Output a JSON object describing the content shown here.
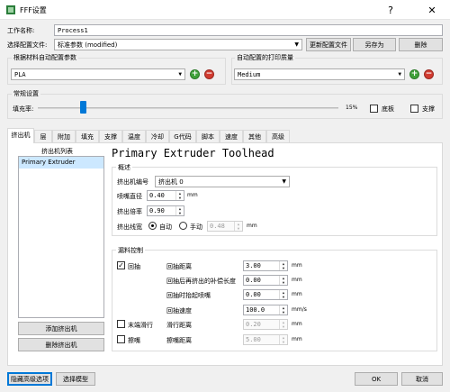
{
  "window": {
    "title": "FFF设置",
    "help_label": "?",
    "close_label": "✕"
  },
  "process": {
    "label": "工作名称:",
    "value": "Process1"
  },
  "profile": {
    "label": "选择配置文件:",
    "value": "标准参数 (modified)",
    "update_button": "更新配置文件",
    "save_as_button": "另存为",
    "delete_button": "删除"
  },
  "material": {
    "group_title": "根据材料自动配置参数",
    "value": "PLA"
  },
  "quality": {
    "group_title": "自动配置的打印质量",
    "value": "Medium"
  },
  "general": {
    "group_title": "常规设置",
    "infill_label": "填充率:",
    "infill_value": "15%",
    "infill_fraction": 0.15,
    "raft_label": "底板",
    "support_label": "支撑"
  },
  "tabs": [
    {
      "label": "挤出机"
    },
    {
      "label": "层"
    },
    {
      "label": "附加"
    },
    {
      "label": "填充"
    },
    {
      "label": "支撑"
    },
    {
      "label": "温度"
    },
    {
      "label": "冷却"
    },
    {
      "label": "G代码"
    },
    {
      "label": "脚本"
    },
    {
      "label": "速度"
    },
    {
      "label": "其他"
    },
    {
      "label": "高级"
    }
  ],
  "extruder_list": {
    "title": "挤出机列表",
    "items": [
      "Primary Extruder"
    ],
    "add_button": "添加挤出机",
    "remove_button": "删除挤出机"
  },
  "extruder": {
    "heading": "Primary Extruder Toolhead",
    "overview_title": "概述",
    "index_label": "挤出机编号",
    "index_value": "挤出机 0",
    "nozzle_label": "喷嘴直径",
    "nozzle_value": "0.40",
    "nozzle_unit": "mm",
    "multiplier_label": "挤出倍率",
    "multiplier_value": "0.90",
    "width_label": "挤出线宽",
    "width_auto": "自动",
    "width_manual": "手动",
    "width_value": "0.48",
    "width_unit": "mm"
  },
  "retraction": {
    "group_title": "漏料控制",
    "retract_label": "回抽",
    "distance_label": "回抽距离",
    "distance_value": "3.00",
    "distance_unit": "mm",
    "extra_label": "回抽后再挤出的补偿长度",
    "extra_value": "0.00",
    "extra_unit": "mm",
    "lift_label": "回抽时抬起喷嘴",
    "lift_value": "0.00",
    "lift_unit": "mm",
    "speed_label": "回抽速度",
    "speed_value": "100.0",
    "speed_unit": "mm/s",
    "coast_label": "末端滑行",
    "coast_dist_label": "滑行距离",
    "coast_value": "0.20",
    "coast_unit": "mm",
    "wipe_label": "擦嘴",
    "wipe_dist_label": "擦嘴距离",
    "wipe_value": "5.00",
    "wipe_unit": "mm"
  },
  "footer": {
    "hide_advanced": "隐藏高级选项",
    "select_models": "选择模型",
    "ok": "OK",
    "cancel": "取消"
  }
}
